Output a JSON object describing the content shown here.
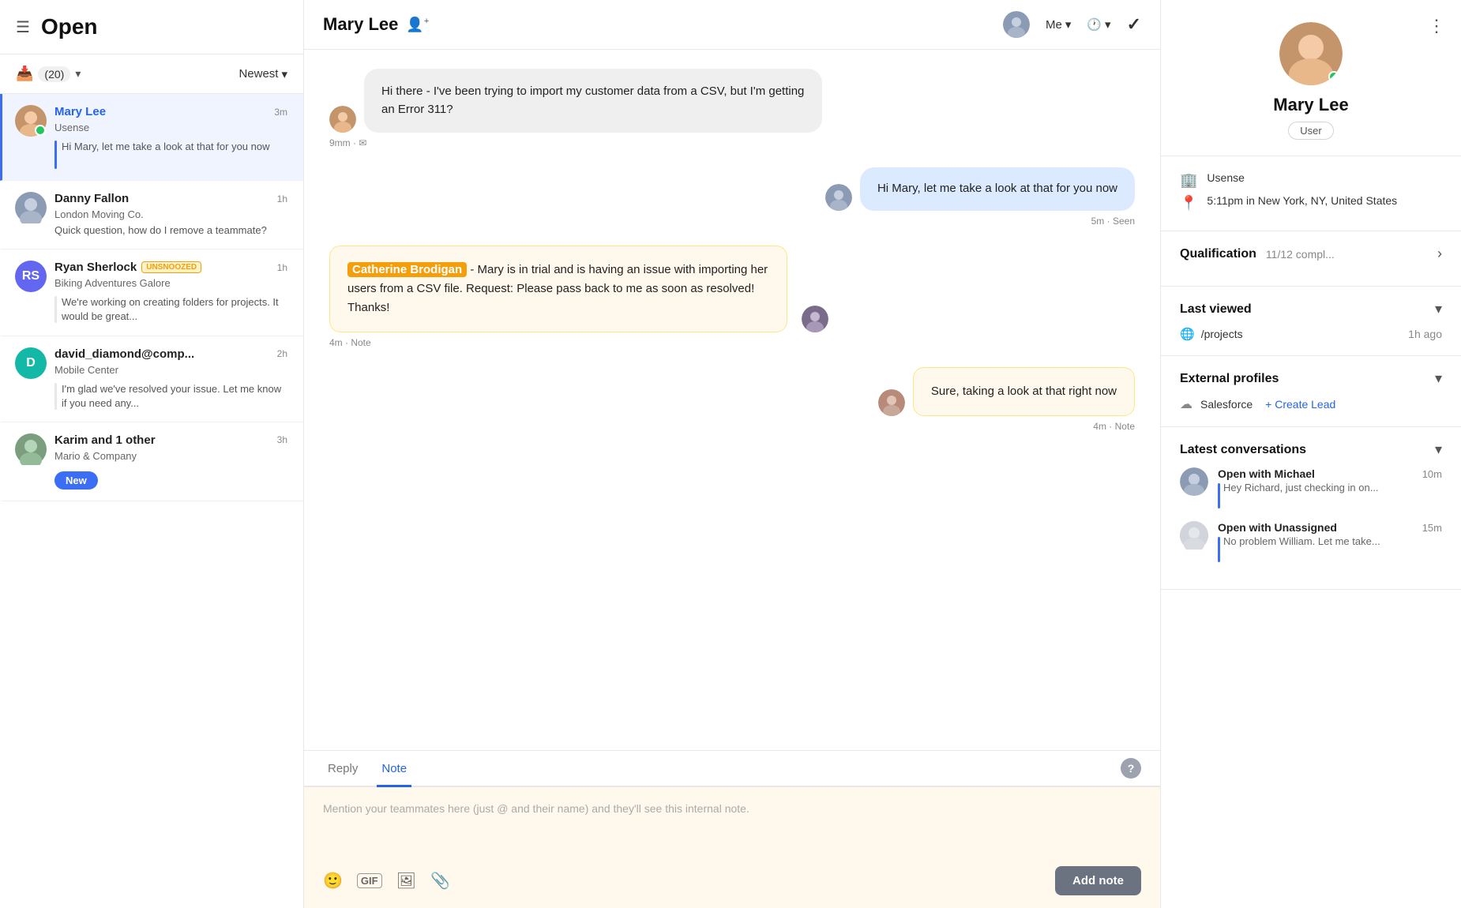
{
  "left": {
    "menu_icon": "☰",
    "title": "Open",
    "inbox_label": "(20)",
    "inbox_dropdown": "▾",
    "sort_label": "Newest",
    "sort_dropdown": "▾",
    "conversations": [
      {
        "id": "mary-lee",
        "name": "Mary Lee",
        "company": "Usense",
        "time": "3m",
        "preview": "Hi Mary, let me take a look at that for you now",
        "active": true,
        "online": true,
        "name_color": "blue"
      },
      {
        "id": "danny-fallon",
        "name": "Danny Fallon",
        "company": "London Moving Co.",
        "time": "1h",
        "preview": "Quick question, how do I remove a teammate?",
        "active": false,
        "online": false,
        "name_color": "dark"
      },
      {
        "id": "ryan-sherlock",
        "name": "Ryan Sherlock",
        "company": "Biking Adventures Galore",
        "time": "1h",
        "preview": "We're working on creating folders for projects. It would be great...",
        "active": false,
        "online": false,
        "name_color": "dark",
        "unsnoozed": "UNSNOOZED"
      },
      {
        "id": "david-diamond",
        "name": "david_diamond@comp...",
        "company": "Mobile Center",
        "time": "2h",
        "preview": "I'm glad we've resolved your issue. Let me know if you need any...",
        "active": false,
        "online": false,
        "name_color": "dark"
      },
      {
        "id": "karim",
        "name": "Karim and 1 other",
        "company": "Mario & Company",
        "time": "3h",
        "preview": "",
        "active": false,
        "online": false,
        "name_color": "dark"
      }
    ]
  },
  "middle": {
    "user_name": "Mary Lee",
    "add_user_icon": "👤+",
    "me_label": "Me",
    "check_icon": "✓",
    "messages": [
      {
        "id": "msg1",
        "type": "inbound",
        "text": "Hi there - I've been trying to import my customer data from a CSV, but I'm getting an Error 311?",
        "time": "9m",
        "channel": "✉",
        "seen": false
      },
      {
        "id": "msg2",
        "type": "outbound",
        "text": "Hi Mary, let me take a look at that for you now",
        "time": "5m",
        "seen": true,
        "seen_label": "Seen"
      },
      {
        "id": "msg3",
        "type": "note",
        "mention": "Catherine Brodigan",
        "text": " - Mary is in trial and is having an issue with importing her users from a CSV file. Request: Please pass back to me as soon as resolved! Thanks!",
        "time": "4m",
        "label": "Note"
      },
      {
        "id": "msg4",
        "type": "note",
        "text": "Sure, taking a look at that right now",
        "time": "4m",
        "label": "Note"
      }
    ],
    "reply_tab": "Reply",
    "note_tab": "Note",
    "note_placeholder": "Mention your teammates here (just @ and their name) and they'll see this internal note.",
    "add_note_btn": "Add note"
  },
  "right": {
    "user_name": "Mary Lee",
    "user_badge": "User",
    "more_icon": "⋮",
    "company": "Usense",
    "location": "5:11pm in New York, NY, United States",
    "qualification_label": "Qualification",
    "qualification_value": "11/12 compl...",
    "last_viewed_label": "Last viewed",
    "last_viewed_path": "/projects",
    "last_viewed_time": "1h ago",
    "external_profiles_label": "External profiles",
    "salesforce_label": "Salesforce",
    "create_lead_label": "+ Create Lead",
    "latest_conv_label": "Latest conversations",
    "conversations": [
      {
        "id": "conv1",
        "title": "Open with Michael",
        "time": "10m",
        "preview": "Hey Richard, just checking in on..."
      },
      {
        "id": "conv2",
        "title": "Open with Unassigned",
        "time": "15m",
        "preview": "No problem William. Let me take..."
      }
    ]
  }
}
